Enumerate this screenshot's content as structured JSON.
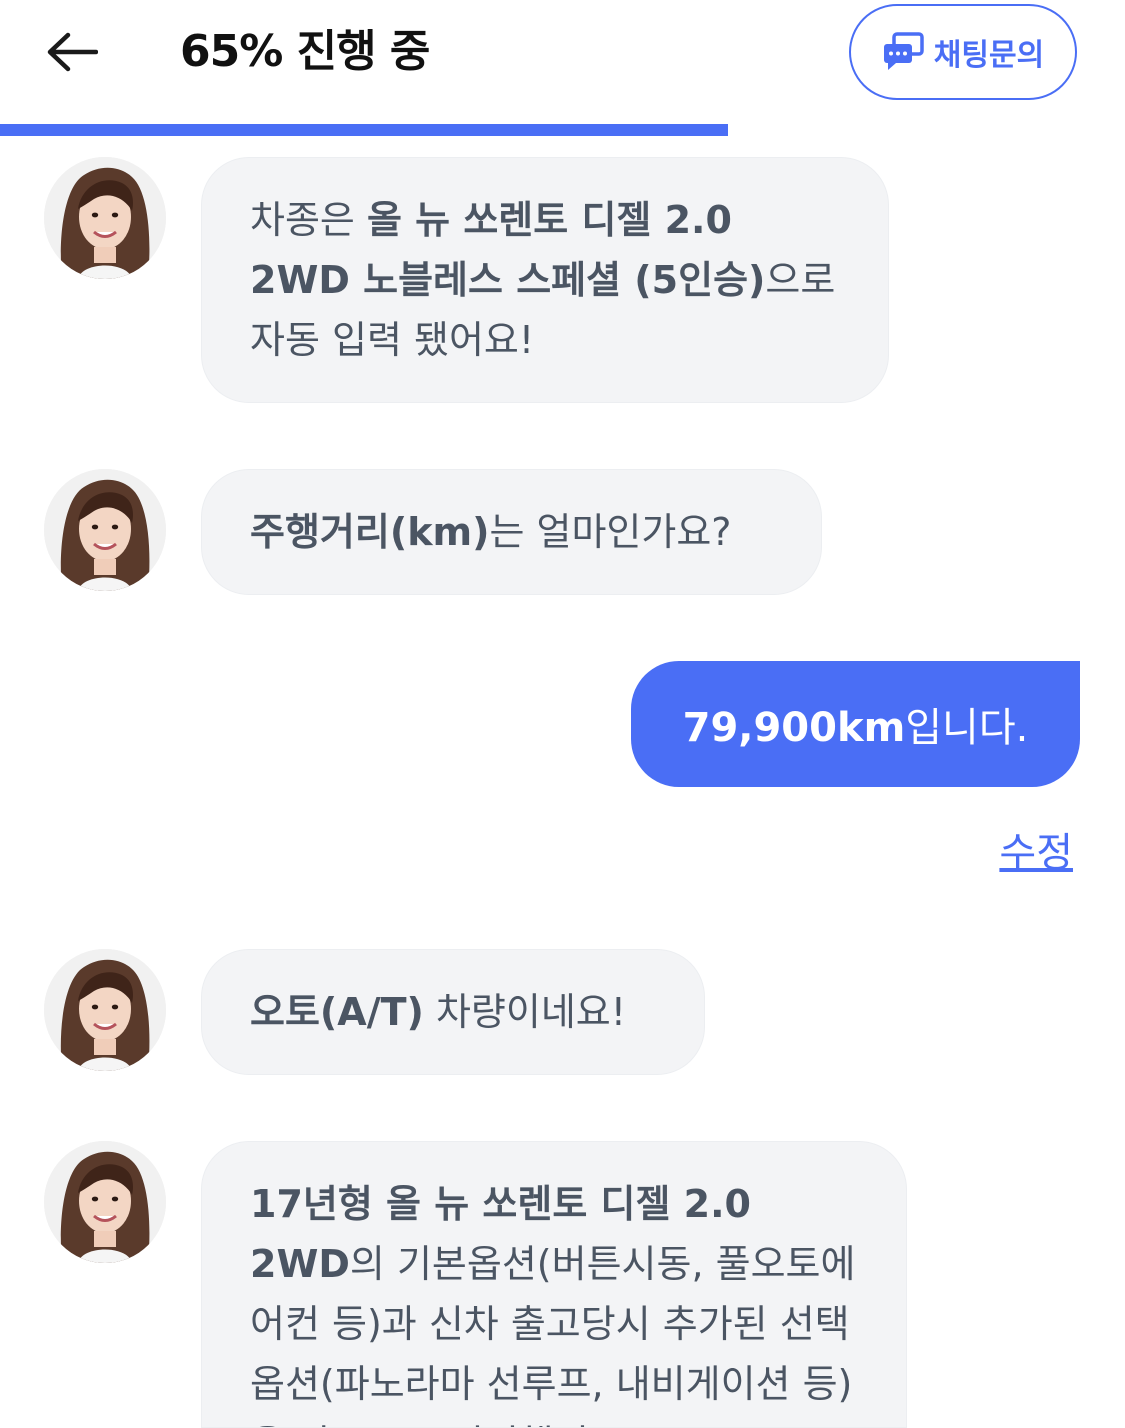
{
  "header": {
    "title": "65% 진행 중",
    "chat_button_label": "채팅문의"
  },
  "progress": {
    "fraction": 0.647
  },
  "messages": {
    "m1": {
      "pre": "차종은 ",
      "strong": "올 뉴 쏘렌토 디젤 2.0 2WD 노블레스 스페셜 (5인승)",
      "post": "으로 자동 입력 됐어요!"
    },
    "m2": {
      "strong": "주행거리(km)",
      "post": "는 얼마인가요?"
    },
    "user": {
      "strong": "79,900km",
      "post": "입니다."
    },
    "edit_label": "수정",
    "m3": {
      "strong": "오토(A/T)",
      "post": " 차량이네요!"
    },
    "m4": {
      "strong": "17년형 올 뉴 쏘렌토 디젤 2.0 2WD",
      "post": "의 기본옵션(버튼시동, 풀오토에어컨 등)과 신차 출고당시 추가된 선택옵션(파노라마 선루프, 내비게이션 등)을 자동으로 입력했어요"
    }
  },
  "colors": {
    "accent": "#4a6ef5",
    "bubble": "#f3f4f6",
    "text": "#4b5563"
  }
}
